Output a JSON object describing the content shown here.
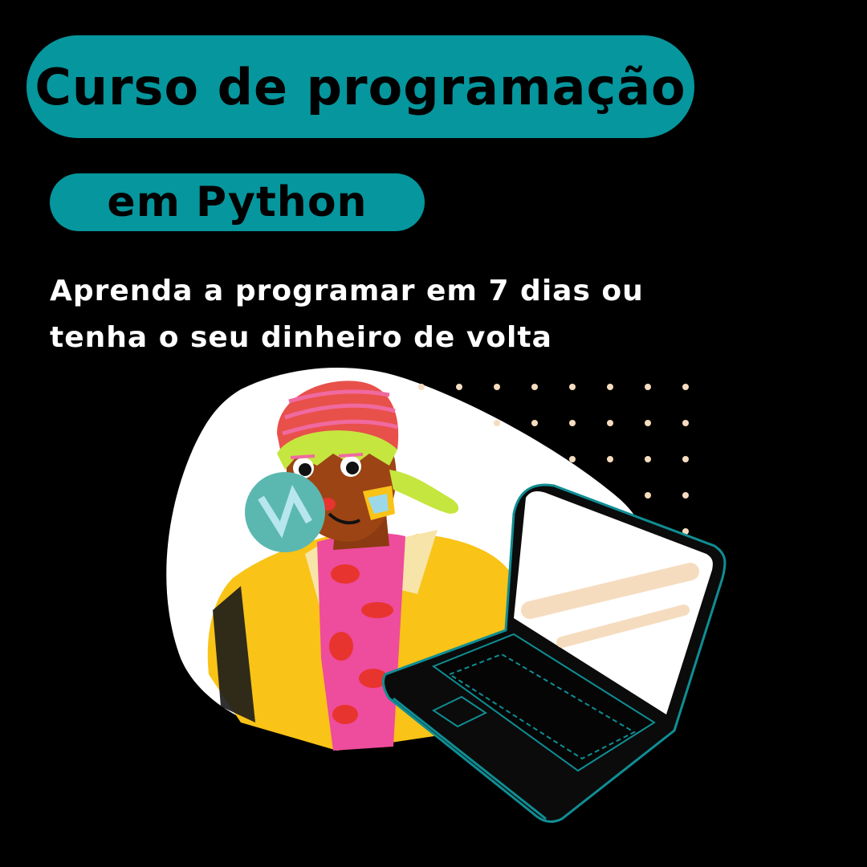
{
  "header": {
    "title": "Curso de programação",
    "subtitle": "em Python"
  },
  "tagline": {
    "line1": "Aprenda a programar em 7 dias ou",
    "line2": "tenha o seu dinheiro de volta"
  },
  "colors": {
    "background": "#000000",
    "accent": "#06969d",
    "text": "#ffffff",
    "dots": "#f6dcbf"
  },
  "illustration": {
    "subject": "woman-with-laptop-illustration",
    "icons": [
      "bubble-gum",
      "laptop-icon",
      "dot-grid"
    ]
  }
}
